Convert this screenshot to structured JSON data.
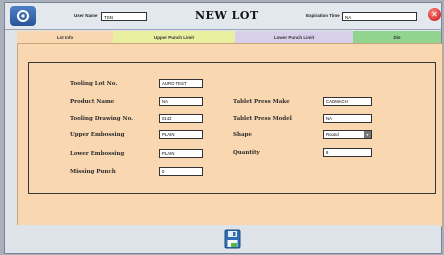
{
  "header": {
    "title": "NEW LOT",
    "user_name_label": "User Name",
    "user_name_value": "TSN",
    "expiration_label": "Expiration Time",
    "expiration_value": "NA"
  },
  "tabs": [
    {
      "label": "Lot Info",
      "color": "#f9d7b0"
    },
    {
      "label": "Upper Punch Limit",
      "color": "#e9ef9e"
    },
    {
      "label": "Lower Punch Limit",
      "color": "#d8d0ea"
    },
    {
      "label": "Die",
      "color": "#90d48f"
    }
  ],
  "left_fields": [
    {
      "label": "Tooling Lot No.",
      "value": "AURO TEST"
    },
    {
      "label": "Product Name",
      "value": "NA"
    },
    {
      "label": "Tooling Drawing No.",
      "value": "0142"
    },
    {
      "label": "Upper Embossing",
      "value": "PLAIN"
    },
    {
      "label": "Lower Embossing",
      "value": "PLAIN"
    },
    {
      "label": "Missing Punch",
      "value": "0"
    }
  ],
  "right_fields": [
    {
      "label": "Tablet Press Make",
      "value": "CADMACH"
    },
    {
      "label": "Tablet Press Model",
      "value": "NA"
    },
    {
      "label": "Shape",
      "value": "Round"
    },
    {
      "label": "Quantity",
      "value": "8"
    }
  ],
  "icons": {
    "app": "app-logo-icon",
    "close": "close-icon",
    "save": "save-icon"
  }
}
